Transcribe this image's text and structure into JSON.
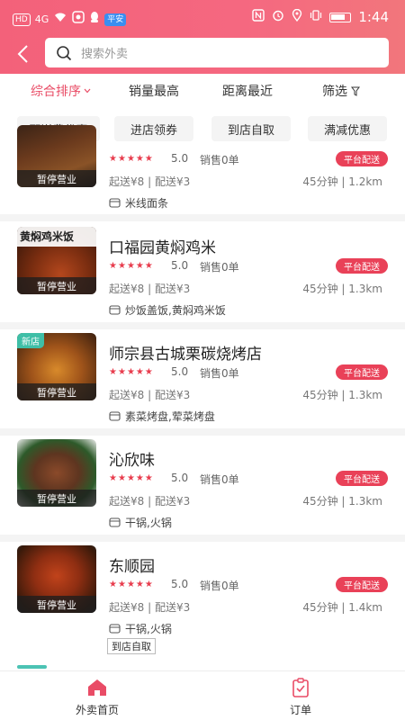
{
  "status_bar": {
    "left_items": [
      "HD",
      "4G",
      "wifi-icon",
      "notification-icon",
      "qq-icon",
      "app-badge"
    ],
    "app_badge_text": "平安",
    "time": "1:44",
    "right_icons": [
      "nfc-icon",
      "alarm-icon",
      "location-icon",
      "vibrate-icon",
      "battery-icon"
    ]
  },
  "header": {
    "search_placeholder": "搜索外卖",
    "brand_color": "#f3617a"
  },
  "sort_bar": {
    "items": [
      "综合排序",
      "销量最高",
      "距离最近",
      "筛选"
    ],
    "active_index": 0,
    "active_color": "#e94c66"
  },
  "chips": [
    "配送费优惠",
    "进店领券",
    "到店自取",
    "满减优惠"
  ],
  "shops": [
    {
      "name": "",
      "status": "暂停营业",
      "rating": "5.0",
      "sales": "销售0单",
      "delivery_tag": "平台配送",
      "fee": "起送¥8 | 配送¥3",
      "distance": "45分钟 | 1.2km",
      "category": "米线面条",
      "new": false
    },
    {
      "name": "口福园黄焖鸡米",
      "status": "暂停营业",
      "rating": "5.0",
      "sales": "销售0单",
      "delivery_tag": "平台配送",
      "fee": "起送¥8 | 配送¥3",
      "distance": "45分钟 | 1.3km",
      "category": "炒饭盖饭,黄焖鸡米饭",
      "thumb_caption": "黄焖鸡米饭",
      "new": false
    },
    {
      "name": "师宗县古城栗碳烧烤店",
      "status": "暂停营业",
      "rating": "5.0",
      "sales": "销售0单",
      "delivery_tag": "平台配送",
      "fee": "起送¥8 | 配送¥3",
      "distance": "45分钟 | 1.3km",
      "category": "素菜烤盘,荤菜烤盘",
      "new_label": "新店",
      "new": true
    },
    {
      "name": "沁欣味",
      "status": "暂停营业",
      "rating": "5.0",
      "sales": "销售0单",
      "delivery_tag": "平台配送",
      "fee": "起送¥8 | 配送¥3",
      "distance": "45分钟 | 1.3km",
      "category": "干锅,火锅",
      "new": false
    },
    {
      "name": "东顺园",
      "status": "暂停营业",
      "rating": "5.0",
      "sales": "销售0单",
      "delivery_tag": "平台配送",
      "fee": "起送¥8 | 配送¥3",
      "distance": "45分钟 | 1.4km",
      "category": "干锅,火锅",
      "pickup_tag": "到店自取",
      "new": false
    }
  ],
  "bottom_nav": {
    "items": [
      {
        "label": "外卖首页",
        "icon": "home-icon",
        "active": true
      },
      {
        "label": "订单",
        "icon": "order-icon",
        "active": false
      }
    ],
    "active_color": "#e94c66"
  }
}
